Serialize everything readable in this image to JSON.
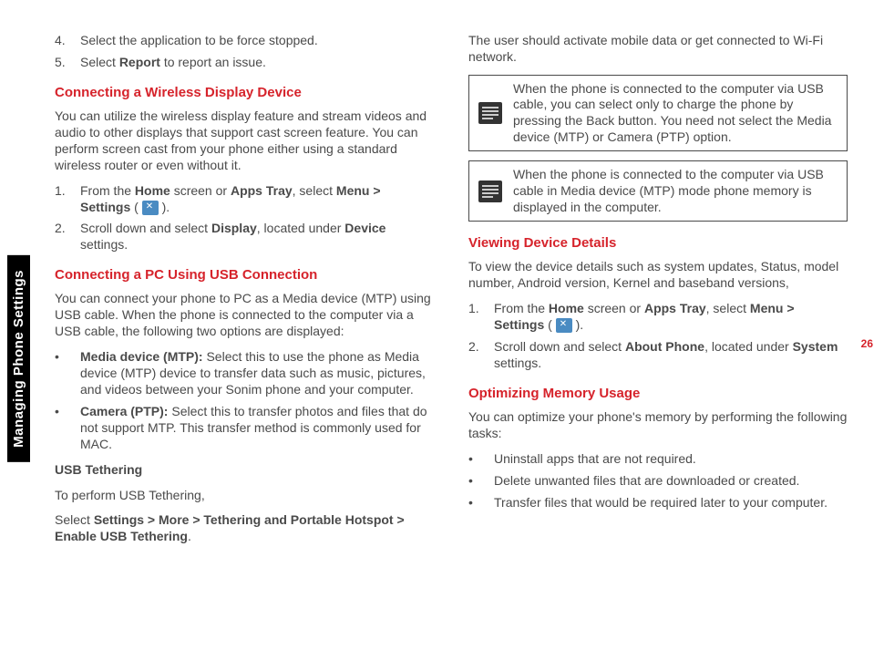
{
  "sideTab": "Managing Phone Settings",
  "pageNum": "26",
  "left": {
    "step4": "Select the application to be force stopped.",
    "step5_a": "Select ",
    "step5_b": "Report",
    "step5_c": " to report an issue.",
    "h1": "Connecting a Wireless Display Device",
    "p1": "You can utilize the wireless display feature and stream videos and audio to other displays that support cast screen feature. You can perform screen cast from your phone either using a standard wireless router or even without it.",
    "s1a": "From the ",
    "s1b": "Home",
    "s1c": " screen or ",
    "s1d": "Apps Tray",
    "s1e": ", select ",
    "s1f": "Menu > Settings",
    "s1g": " ( ",
    "s1h": " ).",
    "s2a": "Scroll down and select ",
    "s2b": "Display",
    "s2c": ", located under ",
    "s2d": "Device",
    "s2e": " settings.",
    "h2": "Connecting a PC Using USB Connection",
    "p2": "You can connect your phone to PC as a Media device (MTP) using USB cable. When the phone is connected to the computer via a USB cable, the following two options are displayed:",
    "mtp_a": "Media device (MTP): ",
    "mtp_b": "Select this to use the phone as Media device (MTP) device to transfer data such as music, pictures, and videos between your Sonim phone and your computer.",
    "ptp_a": "Camera (PTP): ",
    "ptp_b": "Select this to transfer photos and files that do not support MTP. This transfer method is commonly used for MAC.",
    "usbT": "USB Tethering",
    "p3": "To perform USB Tethering,",
    "p4a": "Select ",
    "p4b": "Settings > More > Tethering and Portable Hotspot > Enable USB Tethering",
    "p4c": "."
  },
  "right": {
    "p1": "The user should activate mobile data or get connected to Wi-Fi network.",
    "note1": "When the phone is connected to the computer via USB cable, you can select only to charge the phone by pressing the Back button. You need not select the Media device (MTP) or Camera (PTP) option.",
    "note2": "When the phone is connected to the computer via USB cable in Media device (MTP) mode phone memory is displayed in the computer.",
    "h1": "Viewing Device Details",
    "p2": "To view the device details such as system updates, Status, model number, Android version, Kernel and baseband versions,",
    "s1a": "From the ",
    "s1b": "Home",
    "s1c": " screen or ",
    "s1d": "Apps Tray",
    "s1e": ", select ",
    "s1f": "Menu > Settings",
    "s1g": " ( ",
    "s1h": " ).",
    "s2a": "Scroll down and select ",
    "s2b": "About Phone",
    "s2c": ", located under ",
    "s2d": "System",
    "s2e": " settings.",
    "h2": "Optimizing Memory Usage",
    "p3": "You can optimize your phone's memory by performing the following tasks:",
    "b1": "Uninstall apps that are not required.",
    "b2": "Delete unwanted files that are downloaded or created.",
    "b3": "Transfer files that would be required later to your computer."
  }
}
